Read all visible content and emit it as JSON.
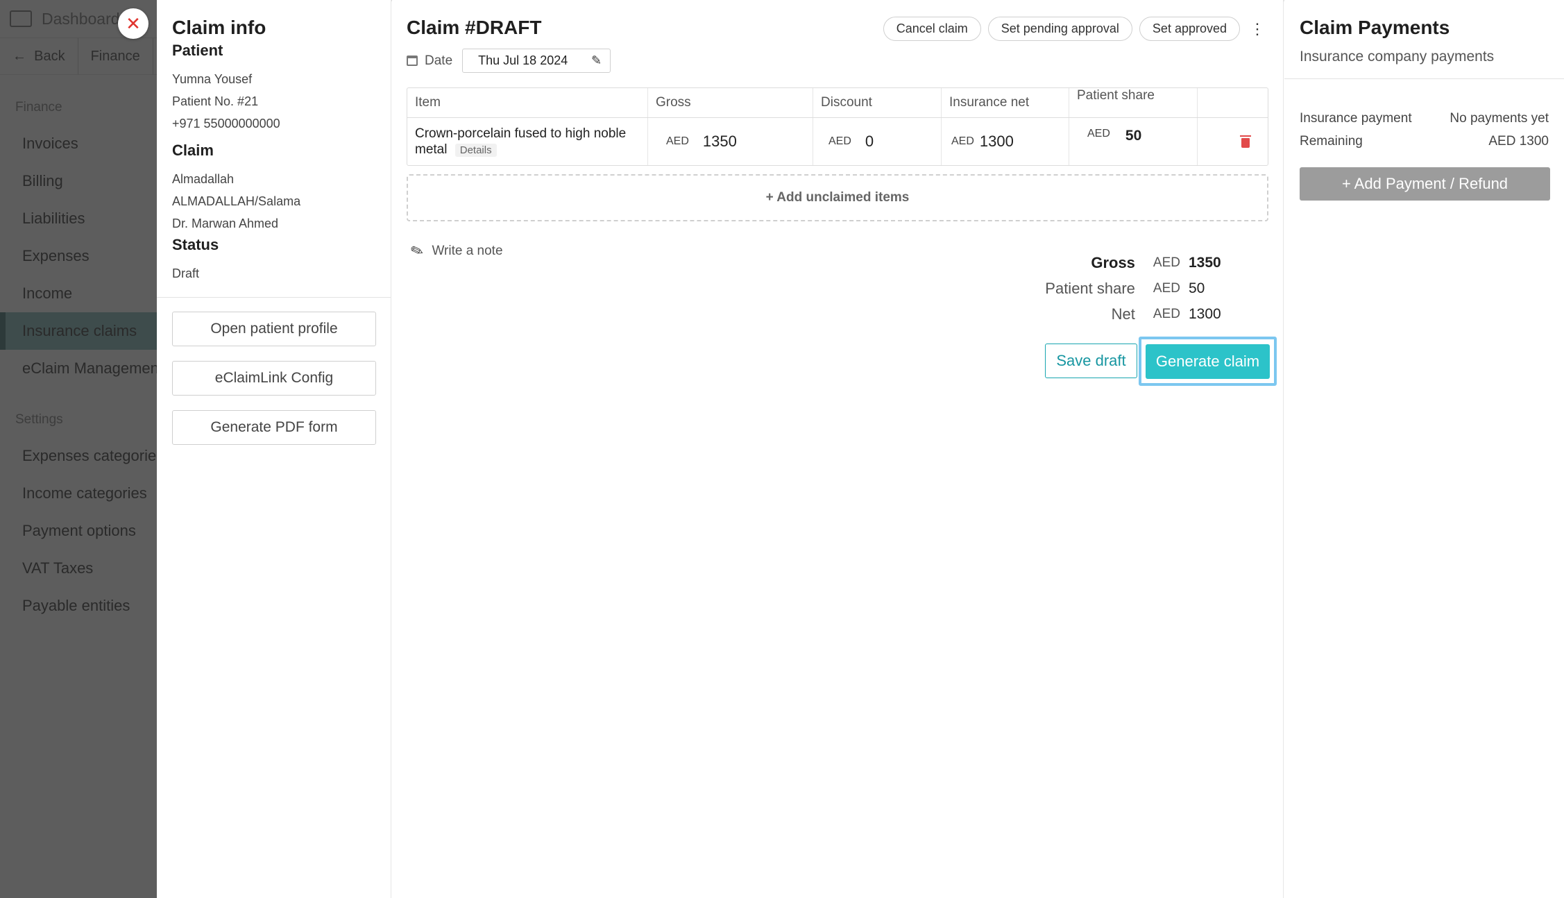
{
  "background_app": {
    "brand": "Dashboard",
    "breadcrumbs": [
      "Back",
      "Finance"
    ],
    "sections": [
      {
        "title": "Finance",
        "items": [
          "Invoices",
          "Billing",
          "Liabilities",
          "Expenses",
          "Income",
          "Insurance claims",
          "eClaim Management"
        ]
      },
      {
        "title": "Settings",
        "items": [
          "Expenses categories",
          "Income categories",
          "Payment options",
          "VAT Taxes",
          "Payable entities"
        ]
      }
    ],
    "active_item": "Insurance claims"
  },
  "claim_info": {
    "title": "Claim info",
    "patient_heading": "Patient",
    "patient_name": "Yumna Yousef",
    "patient_no": "Patient No. #21",
    "patient_phone": "+971 55000000000",
    "claim_heading": "Claim",
    "claim_company": "Almadallah",
    "claim_network": "ALMADALLAH/Salama",
    "claim_doctor": "Dr. Marwan Ahmed",
    "status_heading": "Status",
    "status_value": "Draft",
    "buttons": {
      "open_profile": "Open patient profile",
      "eclaimlink": "eClaimLink Config",
      "generate_pdf": "Generate PDF form"
    }
  },
  "claim": {
    "title": "Claim #DRAFT",
    "actions": {
      "cancel": "Cancel claim",
      "pending": "Set pending approval",
      "approved": "Set approved",
      "more": "⋮"
    },
    "date_label": "Date",
    "date_value": "Thu Jul 18 2024",
    "table": {
      "headers": {
        "item": "Item",
        "gross": "Gross",
        "discount": "Discount",
        "insurance_net": "Insurance net",
        "patient_share": "Patient share"
      },
      "rows": [
        {
          "item": "Crown-porcelain fused to high noble metal",
          "details": "Details",
          "gross_currency": "AED",
          "gross": "1350",
          "discount_currency": "AED",
          "discount": "0",
          "insurance_net_currency": "AED",
          "insurance_net": "1300",
          "patient_share_currency": "AED",
          "patient_share": "50"
        }
      ]
    },
    "add_unclaimed": "+ Add unclaimed items",
    "write_note": "Write a note",
    "totals": {
      "gross_label": "Gross",
      "gross_currency": "AED",
      "gross_value": "1350",
      "patient_label": "Patient share",
      "patient_currency": "AED",
      "patient_value": "50",
      "net_label": "Net",
      "net_currency": "AED",
      "net_value": "1300"
    },
    "save_draft": "Save draft",
    "generate_claim": "Generate claim",
    "colors": {
      "primary": "#2cc3c9",
      "focus_ring": "#7cc7f0",
      "danger": "#e24a4a"
    }
  },
  "payments": {
    "title": "Claim Payments",
    "subtitle": "Insurance company payments",
    "insurance_payment_label": "Insurance payment",
    "insurance_payment_value": "No payments yet",
    "remaining_label": "Remaining",
    "remaining_value": "AED 1300",
    "add_button": "+ Add Payment / Refund"
  }
}
